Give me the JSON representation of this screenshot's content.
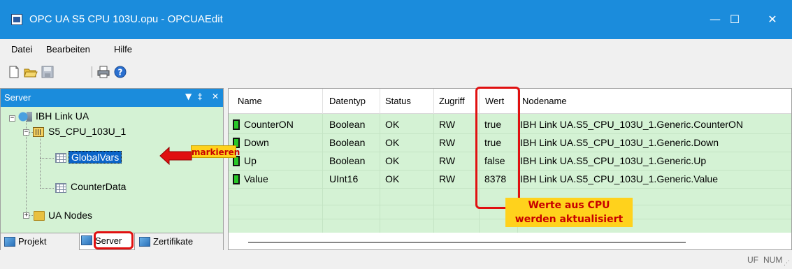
{
  "window": {
    "title": "OPC UA S5 CPU 103U.opu - OPCUAEdit",
    "minimize": "—",
    "maximize": "☐",
    "close": "✕"
  },
  "menu": [
    "Datei",
    "Bearbeiten",
    "Hilfe"
  ],
  "toolbar_icons": [
    "new-icon",
    "open-icon",
    "save-icon",
    "print-icon",
    "help-icon"
  ],
  "server_pane": {
    "title": "Server",
    "controls": [
      "▼",
      "‡",
      "✕"
    ],
    "tree": {
      "root": "IBH Link UA",
      "device": "S5_CPU_103U_1",
      "children": [
        "GlobalVars",
        "CounterData"
      ],
      "other": "UA Nodes"
    },
    "tabs": [
      "Projekt",
      "Server",
      "Zertifikate"
    ],
    "active_tab": "Server"
  },
  "table": {
    "columns": [
      "Name",
      "Datentyp",
      "Status",
      "Zugriff",
      "Wert",
      "Nodename"
    ],
    "rows": [
      {
        "name": "CounterON",
        "type": "Boolean",
        "status": "OK",
        "access": "RW",
        "value": "true",
        "node": "IBH Link UA.S5_CPU_103U_1.Generic.CounterON"
      },
      {
        "name": "Down",
        "type": "Boolean",
        "status": "OK",
        "access": "RW",
        "value": "true",
        "node": "IBH Link UA.S5_CPU_103U_1.Generic.Down"
      },
      {
        "name": "Up",
        "type": "Boolean",
        "status": "OK",
        "access": "RW",
        "value": "false",
        "node": "IBH Link UA.S5_CPU_103U_1.Generic.Up"
      },
      {
        "name": "Value",
        "type": "UInt16",
        "status": "OK",
        "access": "RW",
        "value": "8378",
        "node": "IBH Link UA.S5_CPU_103U_1.Generic.Value"
      }
    ]
  },
  "annotations": {
    "mark": "markieren",
    "cpu_values_line1": "Werte aus CPU",
    "cpu_values_line2": "werden aktualisiert"
  },
  "status": {
    "uf": "UF",
    "num": "NUM"
  },
  "colors": {
    "titlebar": "#1b8cdc",
    "grid_bg": "#d4f2d4",
    "selection": "#0a64c8",
    "highlight": "#e01010",
    "callout": "#ffd21c"
  }
}
